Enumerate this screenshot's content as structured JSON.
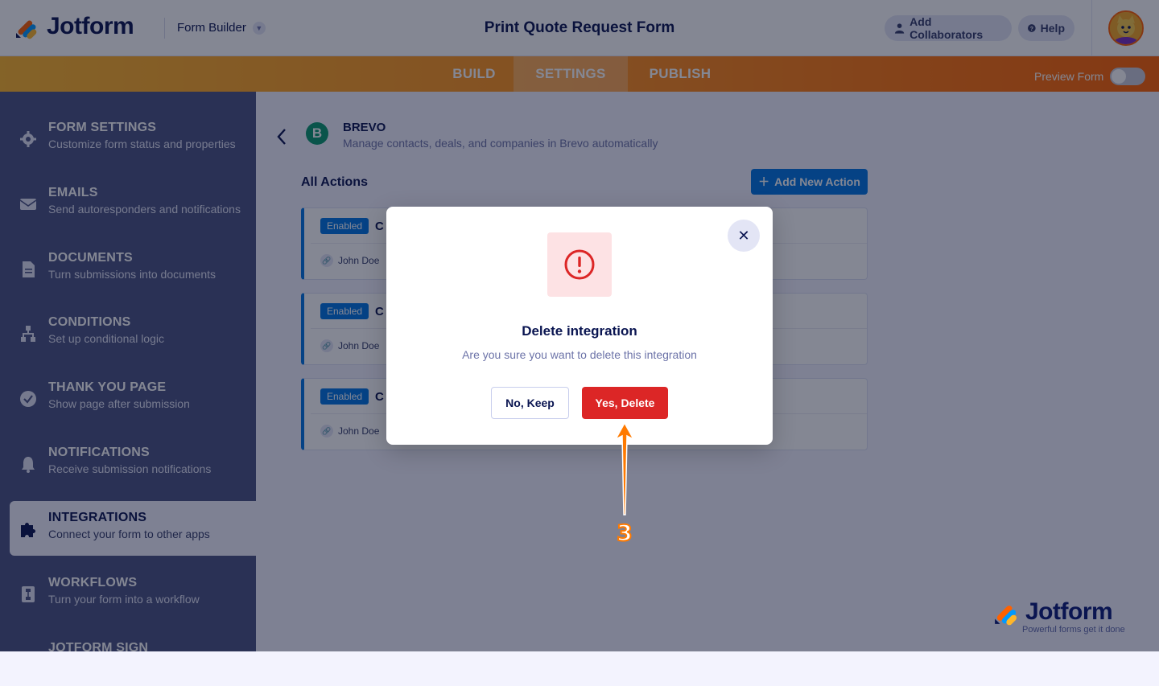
{
  "topbar": {
    "brand": "Jotform",
    "mode": "Form Builder",
    "form_title": "Print Quote Request Form",
    "collaborators": "Add Collaborators",
    "help": "Help"
  },
  "nav": {
    "tabs": [
      "BUILD",
      "SETTINGS",
      "PUBLISH"
    ],
    "active_tab": "SETTINGS",
    "preview_label": "Preview Form",
    "preview_on": false
  },
  "sidebar": {
    "items": [
      {
        "title": "FORM SETTINGS",
        "desc": "Customize form status and properties",
        "icon": "gear-icon"
      },
      {
        "title": "EMAILS",
        "desc": "Send autoresponders and notifications",
        "icon": "envelope-icon"
      },
      {
        "title": "DOCUMENTS",
        "desc": "Turn submissions into documents",
        "icon": "document-icon"
      },
      {
        "title": "CONDITIONS",
        "desc": "Set up conditional logic",
        "icon": "hierarchy-icon"
      },
      {
        "title": "THANK YOU PAGE",
        "desc": "Show page after submission",
        "icon": "checkmark-icon"
      },
      {
        "title": "NOTIFICATIONS",
        "desc": "Receive submission notifications",
        "icon": "bell-icon"
      },
      {
        "title": "INTEGRATIONS",
        "desc": "Connect your form to other apps",
        "icon": "puzzle-icon"
      },
      {
        "title": "WORKFLOWS",
        "desc": "Turn your form into a workflow",
        "icon": "workflow-icon"
      },
      {
        "title": "JOTFORM SIGN",
        "desc": "",
        "icon": "signature-icon"
      }
    ],
    "active": "INTEGRATIONS"
  },
  "integration": {
    "logo_letter": "B",
    "name": "BREVO",
    "description": "Manage contacts, deals, and companies in Brevo automatically",
    "all_actions": "All Actions",
    "add_action": "Add New Action",
    "actions": [
      {
        "status": "Enabled",
        "name": "C",
        "user": "John Doe"
      },
      {
        "status": "Enabled",
        "name": "C",
        "user": "John Doe"
      },
      {
        "status": "Enabled",
        "name": "C",
        "user": "John Doe"
      }
    ]
  },
  "modal": {
    "title": "Delete integration",
    "message": "Are you sure you want to delete this integration",
    "cancel_label": "No, Keep",
    "confirm_label": "Yes, Delete"
  },
  "annotation": {
    "step": "3"
  },
  "watermark": {
    "brand": "Jotform",
    "tagline": "Powerful forms get it done"
  },
  "colors": {
    "navy": "#0a1551",
    "sidebar": "#4a5283",
    "orange_start": "#ffb629",
    "orange_end": "#ff6100",
    "primary_blue": "#0075e3",
    "danger_red": "#dc2626",
    "brevo_green": "#0b996e",
    "pointer_orange": "#ff7a00"
  }
}
